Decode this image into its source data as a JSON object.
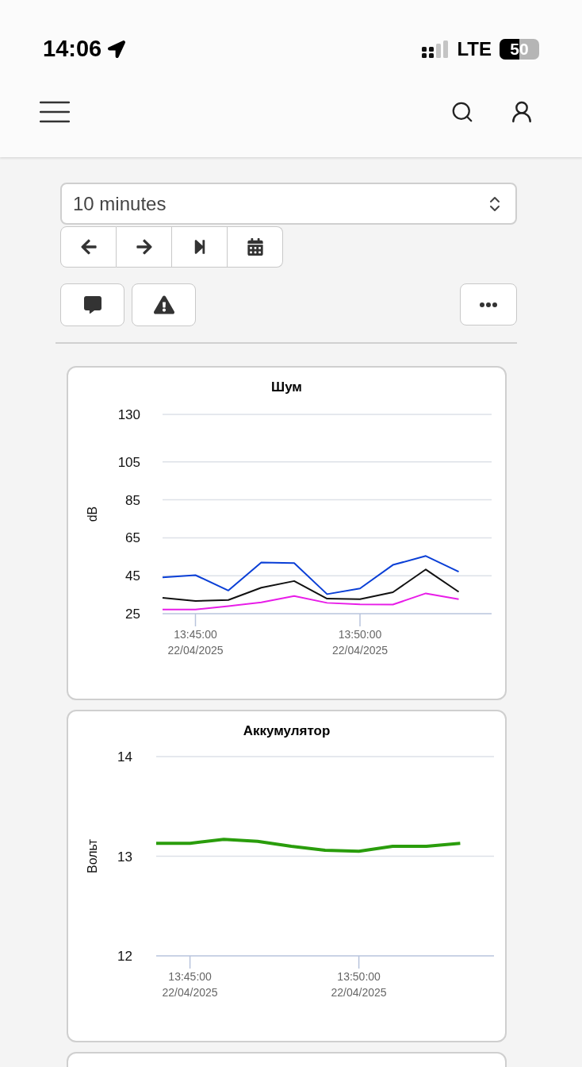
{
  "status_bar": {
    "time": "14:06",
    "network": "LTE",
    "battery": "50"
  },
  "controls": {
    "period": "10 minutes"
  },
  "charts": [
    {
      "title": "Шум",
      "chart_data": {
        "type": "line",
        "ylabel": "dB",
        "categories": [
          null,
          "13:45:00\n22/04/2025",
          null,
          null,
          null,
          null,
          "13:50:00\n22/04/2025",
          null,
          null,
          null
        ],
        "grid": true,
        "ylim": [
          25,
          130
        ],
        "yticks": [
          25,
          45,
          65,
          85,
          105,
          130
        ],
        "series": [
          {
            "color": "#0a3fd6",
            "values": [
              44.1,
              45.3,
              37.2,
              52.0,
              51.7,
              35.3,
              38.3,
              50.7,
              55.4,
              47.1
            ]
          },
          {
            "color": "#111111",
            "values": [
              33.4,
              31.7,
              32.2,
              38.7,
              42.2,
              32.9,
              32.6,
              36.3,
              48.3,
              36.5
            ]
          },
          {
            "color": "#e81ce8",
            "values": [
              27.2,
              27.2,
              29.0,
              31.0,
              34.3,
              30.7,
              29.9,
              29.8,
              35.7,
              32.6
            ]
          }
        ]
      }
    },
    {
      "title": "Аккумулятор",
      "chart_data": {
        "type": "line",
        "ylabel": "Вольт",
        "categories": [
          null,
          "13:45:00\n22/04/2025",
          null,
          null,
          null,
          null,
          "13:50:00\n22/04/2025",
          null,
          null,
          null
        ],
        "grid": true,
        "ylim": [
          12,
          14
        ],
        "yticks": [
          12,
          13,
          14
        ],
        "series": [
          {
            "color": "#2a9d0c",
            "values": [
              13.13,
              13.13,
              13.17,
              13.15,
              13.1,
              13.06,
              13.05,
              13.1,
              13.1,
              13.13
            ]
          }
        ]
      }
    }
  ]
}
